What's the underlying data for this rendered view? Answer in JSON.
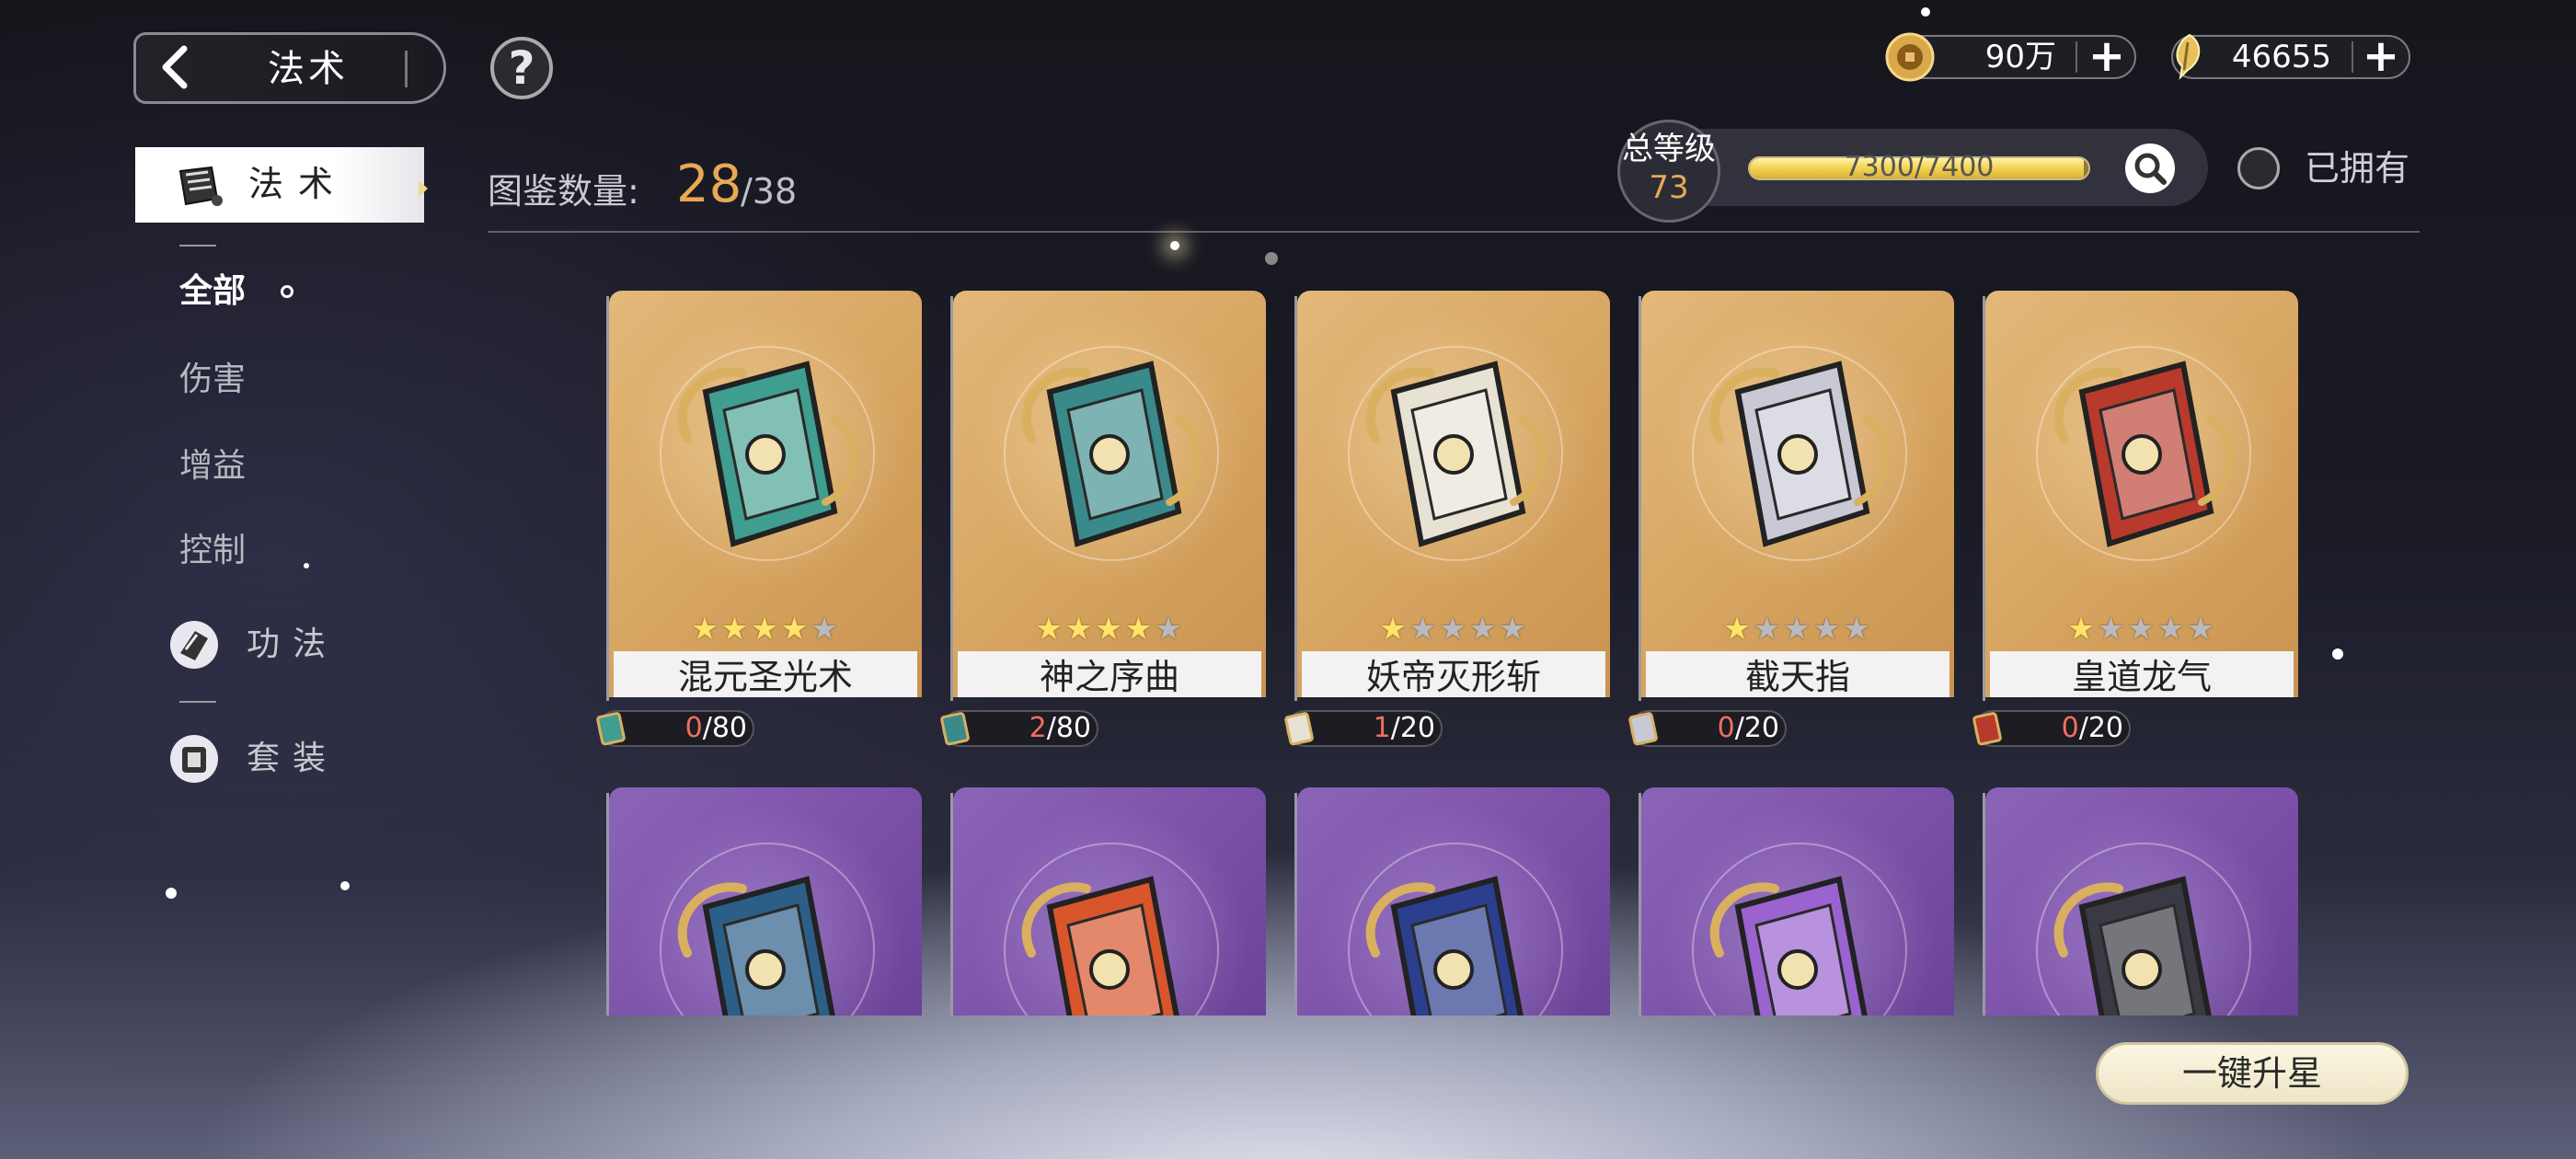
{
  "header": {
    "title": "法术",
    "help_glyph": "?"
  },
  "currencies": [
    {
      "name": "coin",
      "value": "90万",
      "icon": "coin-icon"
    },
    {
      "name": "feather-token",
      "value": "46655",
      "icon": "gold-feather-icon"
    }
  ],
  "sidebar": {
    "active_section": "法术",
    "sub_items": [
      {
        "label": "全部",
        "active": true
      },
      {
        "label": "伤害",
        "active": false
      },
      {
        "label": "增益",
        "active": false
      },
      {
        "label": "控制",
        "active": false
      }
    ],
    "groups": [
      {
        "label": "功法",
        "icon": "scroll-fan-icon"
      },
      {
        "label": "套装",
        "icon": "armor-set-icon"
      }
    ]
  },
  "collection": {
    "label": "图鉴数量:",
    "count": "28",
    "total": "/38"
  },
  "level": {
    "label": "总等级",
    "value": "73",
    "progress_text": "7300/7400",
    "progress_fraction": 0.986
  },
  "filter": {
    "owned_label": "已拥有",
    "owned_checked": false
  },
  "cards_row1": [
    {
      "name": "混元圣光术",
      "stars": 4,
      "max_stars": 5,
      "progress_current": "0",
      "progress_total": "/80",
      "accent": "#3f9e8f"
    },
    {
      "name": "神之序曲",
      "stars": 4,
      "max_stars": 5,
      "progress_current": "2",
      "progress_total": "/80",
      "accent": "#3a8a8c"
    },
    {
      "name": "妖帝灭形斩",
      "stars": 1,
      "max_stars": 5,
      "progress_current": "1",
      "progress_total": "/20",
      "accent": "#e8e2d4"
    },
    {
      "name": "截天指",
      "stars": 1,
      "max_stars": 5,
      "progress_current": "0",
      "progress_total": "/20",
      "accent": "#c9c9d6"
    },
    {
      "name": "皇道龙气",
      "stars": 1,
      "max_stars": 5,
      "progress_current": "0",
      "progress_total": "/20",
      "accent": "#b83a2c"
    }
  ],
  "cards_row2": [
    {
      "accent": "#2c5f88"
    },
    {
      "accent": "#d9552c"
    },
    {
      "accent": "#2b3f8e"
    },
    {
      "accent": "#9a63d0"
    },
    {
      "accent": "#3a3a44"
    }
  ],
  "actions": {
    "one_key_star_up": "一键升星"
  },
  "colors": {
    "accent_orange": "#e8a856",
    "gold_card": "#d6a460",
    "purple_card": "#7b51a8",
    "progress_red": "#f07060"
  }
}
